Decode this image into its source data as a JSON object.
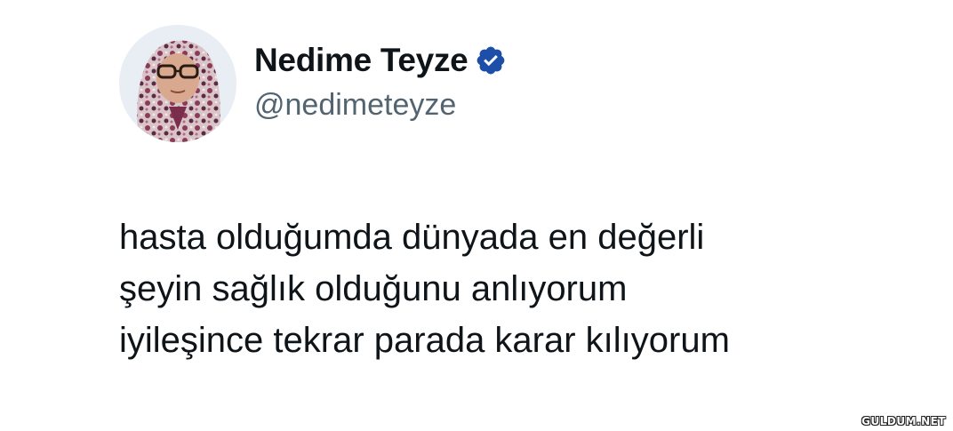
{
  "profile": {
    "display_name": "Nedime Teyze",
    "handle": "@nedimeteyze",
    "verified_icon": "verified-badge-icon",
    "avatar_icon": "avatar-photo"
  },
  "tweet": {
    "lines": [
      "hasta olduğumda dünyada en değerli",
      "şeyin sağlık olduğunu anlıyorum",
      "iyileşince tekrar parada karar kılıyorum"
    ]
  },
  "watermark": {
    "text": "GULDUM.NET"
  },
  "colors": {
    "verified_blue": "#1d9bf0",
    "verified_dark": "#0f3d8a",
    "handle_gray": "#536471",
    "text_black": "#0f1419"
  }
}
